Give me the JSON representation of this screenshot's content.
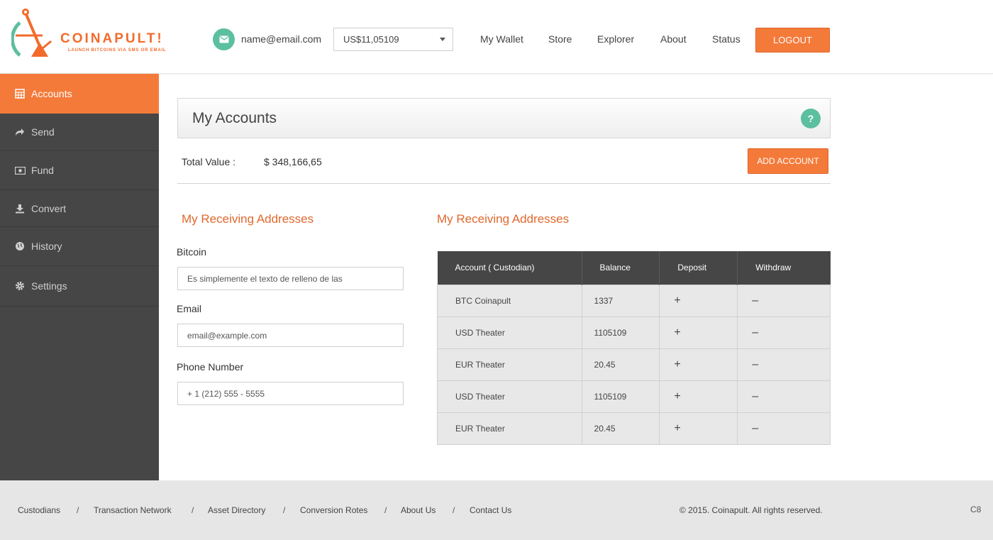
{
  "header": {
    "brand": "COINAPULT!",
    "tagline": "LAUNCH BITCOINS VIA SMS OR EMAIL",
    "email": "name@email.com",
    "currency_selected": "US$11,05109",
    "nav": [
      "My Wallet",
      "Store",
      "Explorer",
      "About",
      "Status"
    ],
    "logout_label": "LOGOUT"
  },
  "sidebar": {
    "items": [
      {
        "label": "Accounts",
        "icon": "calculator-icon",
        "active": true
      },
      {
        "label": "Send",
        "icon": "share-arrow-icon",
        "active": false
      },
      {
        "label": "Fund",
        "icon": "banknote-icon",
        "active": false
      },
      {
        "label": "Convert",
        "icon": "download-icon",
        "active": false
      },
      {
        "label": "History",
        "icon": "globe-icon",
        "active": false
      },
      {
        "label": "Settings",
        "icon": "gear-icon",
        "active": false
      }
    ]
  },
  "main": {
    "title": "My Accounts",
    "help_label": "?",
    "total_label": "Total Value  :",
    "total_value": "$ 348,166,65",
    "add_account_label": "ADD ACCOUNT",
    "receiving": {
      "title": "My Receiving Addresses",
      "bitcoin_label": "Bitcoin",
      "bitcoin_value": "Es simplemente el texto de relleno de las",
      "email_label": "Email",
      "email_placeholder": "email@example.com",
      "phone_label": "Phone Number",
      "phone_value": "+ 1 (212) 555 - 5555"
    },
    "table": {
      "title": "My Receiving Addresses",
      "headers": [
        "Account ( Custodian)",
        "Balance",
        "Deposit",
        "Withdraw"
      ],
      "rows": [
        {
          "account": "BTC Coinapult",
          "balance": "1337",
          "deposit": "+",
          "withdraw": "–"
        },
        {
          "account": "USD Theater",
          "balance": "1105109",
          "deposit": "+",
          "withdraw": "–"
        },
        {
          "account": "EUR Theater",
          "balance": "20.45",
          "deposit": "+",
          "withdraw": "–"
        },
        {
          "account": "USD Theater",
          "balance": "1105109",
          "deposit": "+",
          "withdraw": "–"
        },
        {
          "account": "EUR Theater",
          "balance": "20.45",
          "deposit": "+",
          "withdraw": "–"
        }
      ]
    }
  },
  "footer": {
    "links": [
      "Custodians",
      "Transaction Network",
      "Asset Directory",
      "Conversion Rotes",
      "About Us",
      "Contact Us"
    ],
    "separator": "/",
    "copyright": "© 2015. Coinapult. All rights reserved.",
    "corner": "C8"
  },
  "colors": {
    "accent": "#f47a3a",
    "teal": "#5cbfa0",
    "sidebar": "#464646"
  }
}
